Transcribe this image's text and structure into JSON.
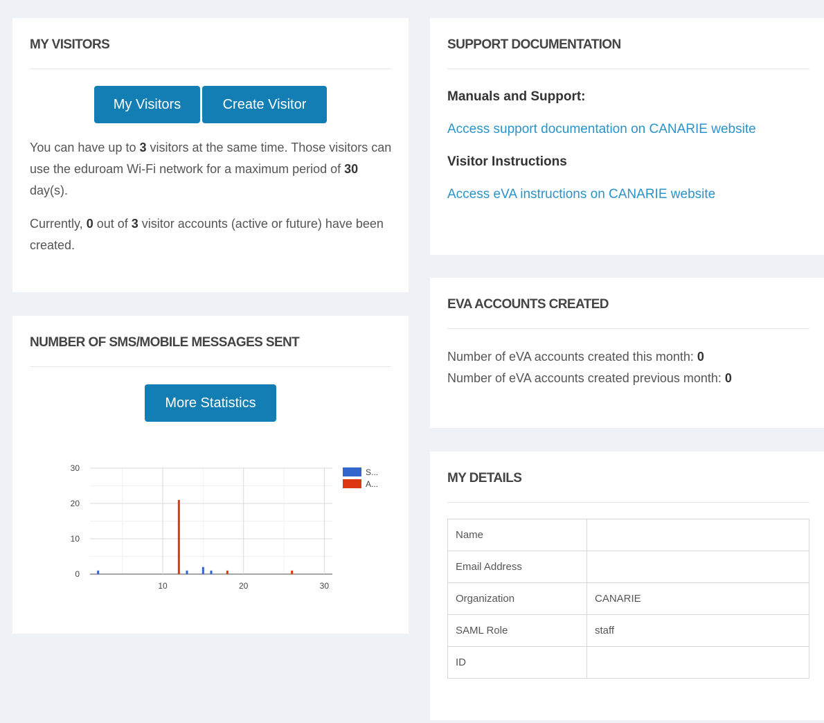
{
  "visitors": {
    "title": "MY VISITORS",
    "my_visitors_label": "My Visitors",
    "create_visitor_label": "Create Visitor",
    "p1_a": "You can have up to ",
    "max_visitors": "3",
    "p1_b": " visitors at the same time. Those visitors can use the eduroam Wi-Fi network for a maximum period of ",
    "max_days": "30",
    "p1_c": " day(s).",
    "p2_a": "Currently, ",
    "current_count": "0",
    "p2_b": " out of ",
    "p2_max": "3",
    "p2_c": " visitor accounts (active or future) have been created."
  },
  "sms": {
    "title": "NUMBER OF SMS/MOBILE MESSAGES SENT",
    "more_stats_label": "More Statistics"
  },
  "support": {
    "title": "SUPPORT DOCUMENTATION",
    "manuals_heading": "Manuals and Support:",
    "manuals_link": "Access support documentation on CANARIE website",
    "visitor_heading": "Visitor Instructions",
    "visitor_link": "Access eVA instructions on CANARIE website"
  },
  "eva": {
    "title": "EVA ACCOUNTS CREATED",
    "this_month_label": "Number of eVA accounts created this month: ",
    "this_month_value": "0",
    "prev_month_label": "Number of eVA accounts created previous month: ",
    "prev_month_value": "0"
  },
  "details": {
    "title": "MY DETAILS",
    "rows": [
      {
        "label": "Name",
        "value": ""
      },
      {
        "label": "Email Address",
        "value": ""
      },
      {
        "label": "Organization",
        "value": "CANARIE"
      },
      {
        "label": "SAML Role",
        "value": "staff"
      },
      {
        "label": "ID",
        "value": ""
      }
    ]
  },
  "chart_data": {
    "type": "bar",
    "title": "",
    "xlabel": "",
    "ylabel": "",
    "xlim": [
      1,
      31
    ],
    "ylim": [
      0,
      30
    ],
    "xticks": [
      10,
      20,
      30
    ],
    "yticks": [
      0,
      10,
      20,
      30
    ],
    "grid": true,
    "legend_position": "right",
    "series": [
      {
        "name": "S...",
        "color": "#3366cc",
        "x": [
          2,
          13,
          15,
          16
        ],
        "values": [
          1,
          1,
          2,
          1
        ]
      },
      {
        "name": "A...",
        "color": "#dc3912",
        "x": [
          12,
          18,
          26
        ],
        "values": [
          21,
          1,
          1
        ]
      }
    ]
  }
}
